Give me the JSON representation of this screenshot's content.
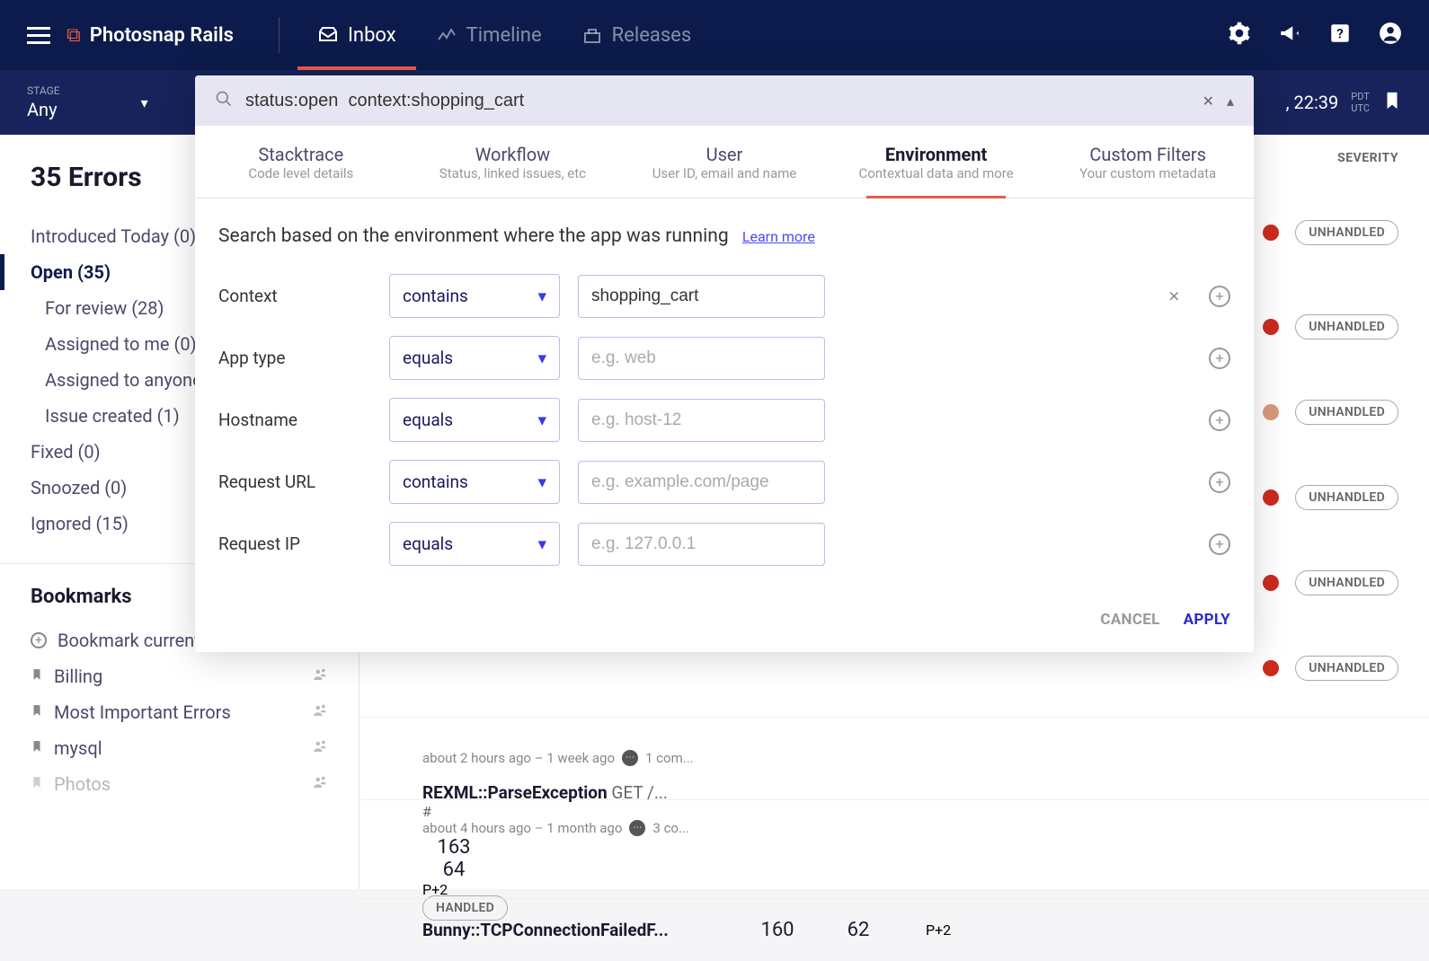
{
  "app_name": "Photosnap Rails",
  "nav": {
    "inbox": "Inbox",
    "timeline": "Timeline",
    "releases": "Releases"
  },
  "subheader": {
    "stage_label": "STAGE",
    "stage_value": "Any",
    "timestamp": ", 22:39",
    "tz1": "PDT",
    "tz2": "UTC"
  },
  "sidebar": {
    "heading": "35 Errors",
    "filters": [
      {
        "label": "Introduced Today (0)",
        "active": false,
        "indented": false
      },
      {
        "label": "Open (35)",
        "active": true,
        "indented": false
      },
      {
        "label": "For review (28)",
        "active": false,
        "indented": true
      },
      {
        "label": "Assigned to me (0)",
        "active": false,
        "indented": true
      },
      {
        "label": "Assigned to anyone",
        "active": false,
        "indented": true
      },
      {
        "label": "Issue created (1)",
        "active": false,
        "indented": true
      },
      {
        "label": "Fixed (0)",
        "active": false,
        "indented": false
      },
      {
        "label": "Snoozed (0)",
        "active": false,
        "indented": false
      },
      {
        "label": "Ignored (15)",
        "active": false,
        "indented": false
      }
    ],
    "bookmarks_heading": "Bookmarks",
    "bookmark_add": "Bookmark current search",
    "bookmarks": [
      "Billing",
      "Most Important Errors",
      "mysql",
      "Photos"
    ]
  },
  "main": {
    "severity_header": "SEVERITY",
    "rows": [
      {
        "sev": "red",
        "pill": "UNHANDLED"
      },
      {
        "sev": "red",
        "pill": "UNHANDLED"
      },
      {
        "sev": "amber",
        "pill": "UNHANDLED"
      },
      {
        "sev": "red",
        "pill": "UNHANDLED"
      },
      {
        "sev": "red",
        "pill": "UNHANDLED"
      },
      {
        "sev": "red",
        "pill": "UNHANDLED"
      }
    ],
    "errors": [
      {
        "title_full": "",
        "method": "",
        "sub": "",
        "time": "about 2 hours ago – 1 week ago",
        "comments": "1 com...",
        "c1": "",
        "c2": "",
        "p": "",
        "plus": "",
        "sev": "",
        "pill": ""
      },
      {
        "title": "REXML::ParseException",
        "method": "GET /...",
        "sub": "#<RuntimeError: Illegal character '&' i...",
        "time": "about 4 hours ago – 1 month ago",
        "comments": "3 co...",
        "c1": "163",
        "c2": "64",
        "p": "P",
        "plus": "+2",
        "sev": "amber",
        "pill": "HANDLED"
      },
      {
        "title": "Bunny::TCPConnectionFailedF...",
        "method": "",
        "sub": "",
        "time": "",
        "comments": "",
        "c1": "160",
        "c2": "62",
        "p": "P",
        "plus": "+2",
        "sev": "",
        "pill": ""
      }
    ]
  },
  "modal": {
    "search_value": "status:open  context:shopping_cart",
    "tabs": [
      {
        "title": "Stacktrace",
        "sub": "Code level details"
      },
      {
        "title": "Workflow",
        "sub": "Status, linked issues, etc"
      },
      {
        "title": "User",
        "sub": "User ID, email and name"
      },
      {
        "title": "Environment",
        "sub": "Contextual data and more"
      },
      {
        "title": "Custom Filters",
        "sub": "Your custom metadata"
      }
    ],
    "active_tab": 3,
    "description": "Search based on the environment where the app was running",
    "learn_more": "Learn more",
    "rows": [
      {
        "label": "Context",
        "op": "contains",
        "value": "shopping_cart",
        "placeholder": ""
      },
      {
        "label": "App type",
        "op": "equals",
        "value": "",
        "placeholder": "e.g. web"
      },
      {
        "label": "Hostname",
        "op": "equals",
        "value": "",
        "placeholder": "e.g. host-12"
      },
      {
        "label": "Request URL",
        "op": "contains",
        "value": "",
        "placeholder": "e.g. example.com/page"
      },
      {
        "label": "Request IP",
        "op": "equals",
        "value": "",
        "placeholder": "e.g. 127.0.0.1"
      }
    ],
    "cancel": "CANCEL",
    "apply": "APPLY"
  }
}
